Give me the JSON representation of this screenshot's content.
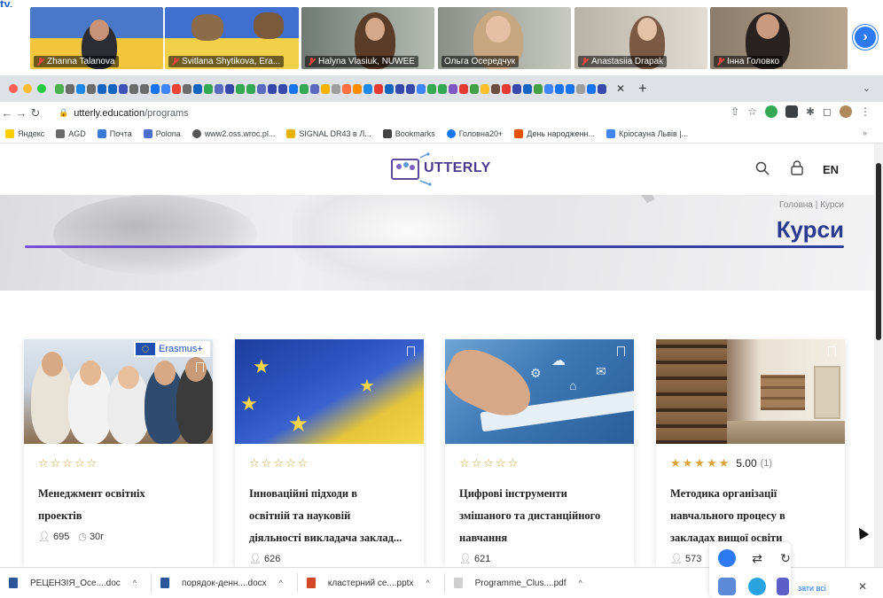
{
  "zoom": {
    "top_fragment": "ty.",
    "participants": [
      {
        "name": "Zhanna Talanova"
      },
      {
        "name": "Svitlana Shytikova, Era..."
      },
      {
        "name": "Halyna Vlasiuk, NUWEE"
      },
      {
        "name": "Ольга Осередчук"
      },
      {
        "name": "Anastasiia Drapak"
      },
      {
        "name": "Інна Головко"
      }
    ]
  },
  "browser": {
    "url_host": "utterly.education",
    "url_path": "/programs",
    "bookmarks": [
      {
        "label": "Яндекс",
        "icon": "yandex-icon",
        "color": "#ffcc00"
      },
      {
        "label": "AGD",
        "icon": "folder-icon",
        "color": "#6b6b6b"
      },
      {
        "label": "Почта",
        "icon": "mail-icon",
        "color": "#3a7bd5"
      },
      {
        "label": "Polona",
        "icon": "slash-icon",
        "color": "#4a6fd1"
      },
      {
        "label": "www2.oss.wroc.pl...",
        "icon": "globe-icon",
        "color": "#555555"
      },
      {
        "label": "SIGNAL DR43 в Л...",
        "icon": "signal-icon",
        "color": "#e8b200"
      },
      {
        "label": "Bookmarks",
        "icon": "star-icon",
        "color": "#444444"
      },
      {
        "label": "Головна20+",
        "icon": "facebook-icon",
        "color": "#1877f2"
      },
      {
        "label": "День народженн...",
        "icon": "pin-icon",
        "color": "#e65100"
      },
      {
        "label": "Кріосауна Львів |...",
        "icon": "google-icon",
        "color": "#4285f4"
      }
    ],
    "bookmarks_more": "»"
  },
  "site": {
    "logo_text": "UTTERLY",
    "lang": "EN",
    "breadcrumb": "Головна | Курси",
    "title": "Курси",
    "accent_color": "#2b3a8f",
    "courses": [
      {
        "title_line1": "Менеджмент освітніх",
        "title_line2": "проектів",
        "title_line3": "",
        "stars_filled": 0,
        "rating": "",
        "rating_count": "",
        "students": "695",
        "duration": "30г",
        "badge": "Erasmus+"
      },
      {
        "title_line1": "Інноваційні підходи в",
        "title_line2": "освітній та науковій",
        "title_line3": "діяльності викладача заклад...",
        "stars_filled": 0,
        "rating": "",
        "rating_count": "",
        "students": "626",
        "duration": ""
      },
      {
        "title_line1": "Цифрові інструменти",
        "title_line2": "змішаного та дистанційного",
        "title_line3": "навчання",
        "stars_filled": 0,
        "rating": "",
        "rating_count": "",
        "students": "621",
        "duration": ""
      },
      {
        "title_line1": "Методика організації",
        "title_line2": "навчального процесу в",
        "title_line3": "закладах вищої освіти",
        "stars_filled": 5,
        "rating": "5.00",
        "rating_count": "(1)",
        "students": "573",
        "duration": ""
      }
    ]
  },
  "downloads": {
    "items": [
      {
        "name": "РЕЦЕНЗІЯ_Осе....doc",
        "color": "#2b579a"
      },
      {
        "name": "порядок-денн....docx",
        "color": "#2b579a"
      },
      {
        "name": "кластерний се....pptx",
        "color": "#d24726"
      },
      {
        "name": "Programme_Clus....pdf",
        "color": "#bbbbbb"
      }
    ],
    "show_all": "зати всі",
    "close": "✕"
  }
}
